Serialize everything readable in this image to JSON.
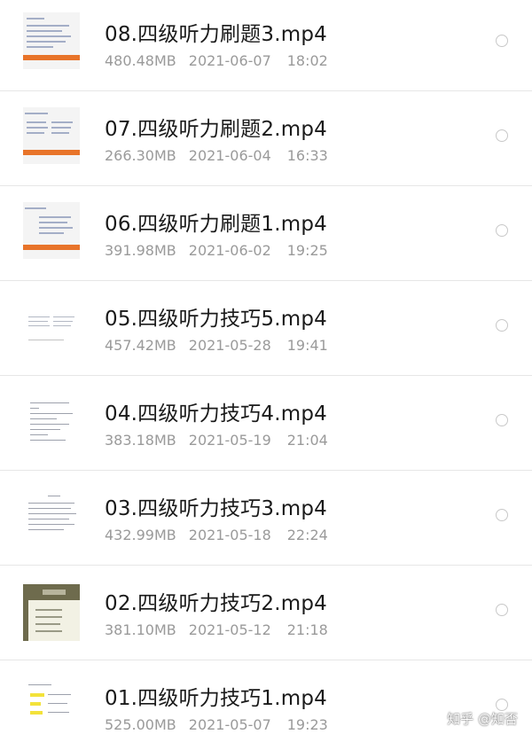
{
  "files": [
    {
      "name": "08.四级听力刷题3.mp4",
      "size": "480.48MB",
      "date": "2021-06-07",
      "time": "18:02",
      "thumb": "orange-slide"
    },
    {
      "name": "07.四级听力刷题2.mp4",
      "size": "266.30MB",
      "date": "2021-06-04",
      "time": "16:33",
      "thumb": "orange-slide"
    },
    {
      "name": "06.四级听力刷题1.mp4",
      "size": "391.98MB",
      "date": "2021-06-02",
      "time": "19:25",
      "thumb": "orange-slide"
    },
    {
      "name": "05.四级听力技巧5.mp4",
      "size": "457.42MB",
      "date": "2021-05-28",
      "time": "19:41",
      "thumb": "text-slide"
    },
    {
      "name": "04.四级听力技巧4.mp4",
      "size": "383.18MB",
      "date": "2021-05-19",
      "time": "21:04",
      "thumb": "text-slide"
    },
    {
      "name": "03.四级听力技巧3.mp4",
      "size": "432.99MB",
      "date": "2021-05-18",
      "time": "22:24",
      "thumb": "text-slide"
    },
    {
      "name": "02.四级听力技巧2.mp4",
      "size": "381.10MB",
      "date": "2021-05-12",
      "time": "21:18",
      "thumb": "dark-slide"
    },
    {
      "name": "01.四级听力技巧1.mp4",
      "size": "525.00MB",
      "date": "2021-05-07",
      "time": "19:23",
      "thumb": "highlight-slide"
    }
  ],
  "watermark": "知乎 @知否"
}
